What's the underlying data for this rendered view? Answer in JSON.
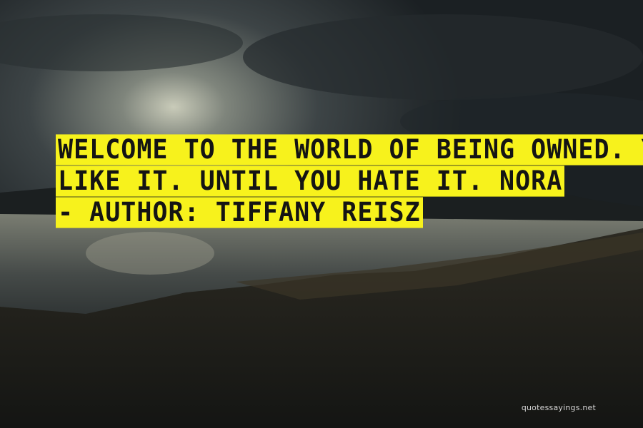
{
  "quote": {
    "line1": "WELCOME TO THE WORLD OF BEING OWNED. YOU'LL",
    "line2": "LIKE IT. UNTIL YOU HATE IT. NORA",
    "author_line": "- AUTHOR: TIFFANY REISZ"
  },
  "watermark": "quotessayings.net",
  "colors": {
    "highlight": "#f7f21c",
    "text": "#141414"
  }
}
